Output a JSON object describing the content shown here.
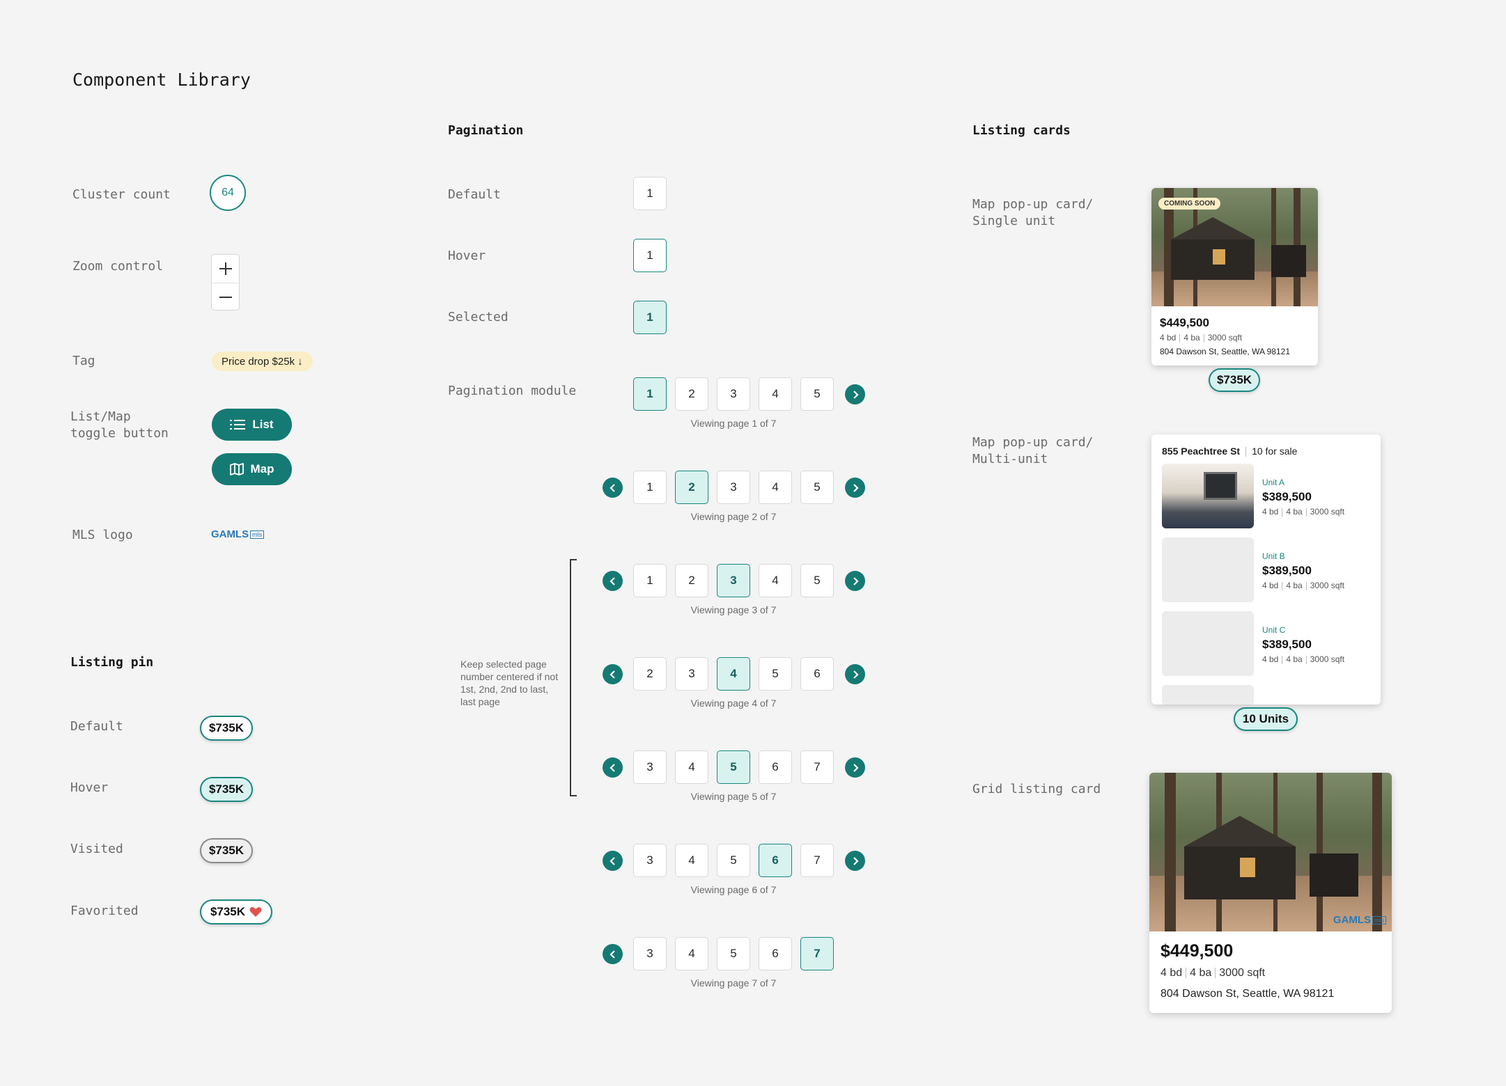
{
  "page_title": "Component Library",
  "left": {
    "cluster_label": "Cluster count",
    "cluster_value": "64",
    "zoom_label": "Zoom control",
    "zoom_plus": "+",
    "zoom_minus": "−",
    "tag_label": "Tag",
    "tag_text": "Price drop $25k",
    "tag_arrow": "↓",
    "toggle_label": "List/Map\ntoggle button",
    "toggle_list": "List",
    "toggle_map": "Map",
    "mls_label": "MLS logo",
    "mls_text": "GAMLS",
    "mls_box": "mls"
  },
  "listing_pin": {
    "section": "Listing pin",
    "states": [
      {
        "label": "Default",
        "value": "$735K"
      },
      {
        "label": "Hover",
        "value": "$735K"
      },
      {
        "label": "Visited",
        "value": "$735K"
      },
      {
        "label": "Favorited",
        "value": "$735K"
      }
    ]
  },
  "pagination": {
    "section": "Pagination",
    "default_label": "Default",
    "hover_label": "Hover",
    "selected_label": "Selected",
    "single_page": "1",
    "module_label": "Pagination module",
    "note": "Keep selected page number centered if not 1st, 2nd, 2nd to last, last page",
    "rows": [
      {
        "pages": [
          "1",
          "2",
          "3",
          "4",
          "5"
        ],
        "selected": "1",
        "viewing": "Viewing page 1 of 7"
      },
      {
        "pages": [
          "1",
          "2",
          "3",
          "4",
          "5"
        ],
        "selected": "2",
        "viewing": "Viewing page 2 of 7"
      },
      {
        "pages": [
          "1",
          "2",
          "3",
          "4",
          "5"
        ],
        "selected": "3",
        "viewing": "Viewing page 3 of 7"
      },
      {
        "pages": [
          "2",
          "3",
          "4",
          "5",
          "6"
        ],
        "selected": "4",
        "viewing": "Viewing page 4 of 7"
      },
      {
        "pages": [
          "3",
          "4",
          "5",
          "6",
          "7"
        ],
        "selected": "5",
        "viewing": "Viewing page 5 of 7"
      },
      {
        "pages": [
          "3",
          "4",
          "5",
          "6",
          "7"
        ],
        "selected": "6",
        "viewing": "Viewing page 6 of 7"
      },
      {
        "pages": [
          "3",
          "4",
          "5",
          "6",
          "7"
        ],
        "selected": "7",
        "viewing": "Viewing page 7 of 7"
      }
    ]
  },
  "cards": {
    "section": "Listing cards",
    "single_label": "Map pop-up card/\nSingle unit",
    "single": {
      "badge": "COMING SOON",
      "price": "$449,500",
      "beds": "4 bd",
      "baths": "4 ba",
      "sqft": "3000 sqft",
      "address": "804 Dawson St, Seattle, WA 98121",
      "pin": "$735K"
    },
    "multi_label": "Map pop-up card/\nMulti-unit",
    "multi": {
      "building": "855 Peachtree St",
      "count": "10 for sale",
      "units": [
        {
          "name": "Unit A",
          "price": "$389,500",
          "beds": "4 bd",
          "baths": "4 ba",
          "sqft": "3000 sqft"
        },
        {
          "name": "Unit B",
          "price": "$389,500",
          "beds": "4 bd",
          "baths": "4 ba",
          "sqft": "3000 sqft"
        },
        {
          "name": "Unit C",
          "price": "$389,500",
          "beds": "4 bd",
          "baths": "4 ba",
          "sqft": "3000 sqft"
        }
      ],
      "pin": "10 Units"
    },
    "grid_label": "Grid listing card",
    "grid": {
      "price": "$449,500",
      "beds": "4 bd",
      "baths": "4 ba",
      "sqft": "3000 sqft",
      "address": "804 Dawson St, Seattle, WA 98121",
      "mls": "GAMLS",
      "mls_box": "mls"
    }
  },
  "colors": {
    "teal": "#157a73",
    "teal_light": "#d8f2ef",
    "tag": "#fbedc5",
    "heart": "#e0534f"
  }
}
